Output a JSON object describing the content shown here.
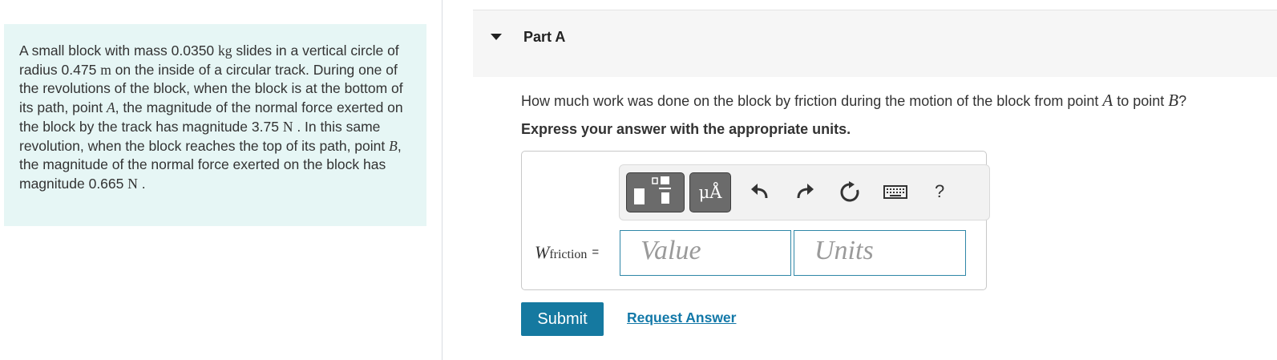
{
  "problem": {
    "t1": "A small block with mass 0.0350 ",
    "u_kg": "kg",
    "t2": " slides in a vertical circle of radius 0.475 ",
    "u_m": "m",
    "t3": " on the inside of a circular track. During one of the revolutions of the block, when the block is at the bottom of its path, point ",
    "pt_a": "A",
    "t4": ", the magnitude of the normal force exerted on the block by the track has magnitude 3.75 ",
    "u_n1": "N",
    "t5": " . In this same revolution, when the block reaches the top of its path, point ",
    "pt_b": "B",
    "t6": ", the magnitude of the normal force exerted on the block has magnitude 0.665 ",
    "u_n2": "N",
    "t7": " ."
  },
  "part": {
    "title": "Part A"
  },
  "question": {
    "t1": "How much work was done on the block by friction during the motion of the block from point ",
    "a": "A",
    "t2": " to point ",
    "b": "B",
    "t3": "?"
  },
  "instruction": "Express your answer with the appropriate units.",
  "toolbar": {
    "symbols_label": "μÅ",
    "help_label": "?",
    "icons": [
      "templates-icon",
      "undo-icon",
      "redo-icon",
      "reset-icon",
      "keyboard-icon",
      "help-icon"
    ]
  },
  "answer": {
    "var_letter": "W",
    "var_subscript": "friction",
    "equals": "=",
    "value_placeholder": "Value",
    "units_placeholder": "Units"
  },
  "actions": {
    "submit_label": "Submit",
    "request_label": "Request Answer"
  },
  "colors": {
    "problem_bg": "#e6f6f5",
    "accent": "#1579a0",
    "link": "#1278a8",
    "input_border": "#2f87a7"
  }
}
